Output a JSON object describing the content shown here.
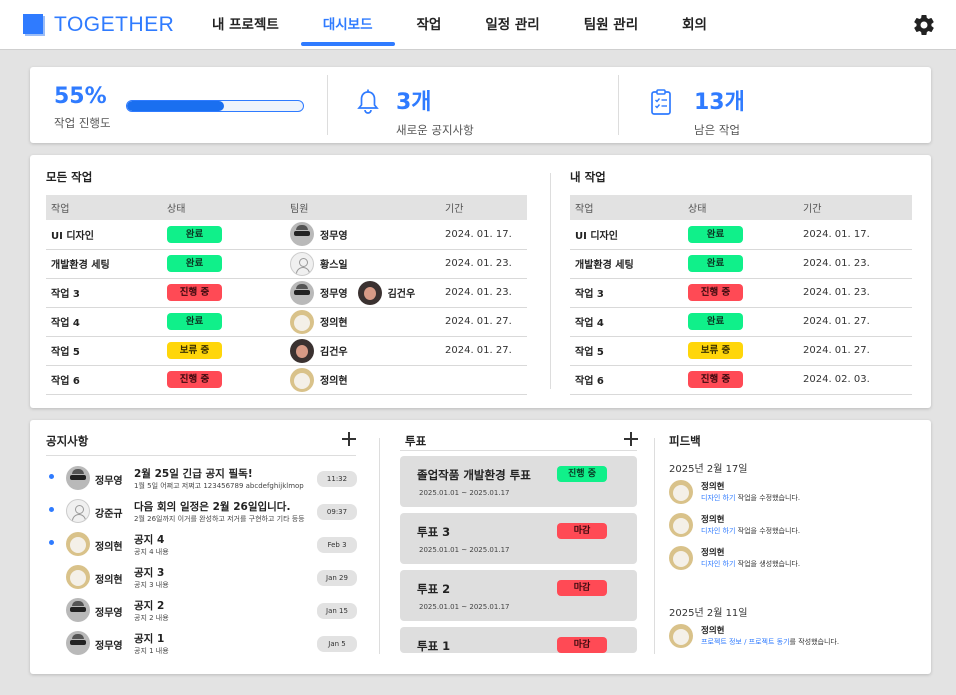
{
  "app": {
    "logo": "TOGETHER",
    "accent": "#2f7bff"
  },
  "nav": {
    "items": [
      "내 프로젝트",
      "대시보드",
      "작업",
      "일정 관리",
      "팀원 관리",
      "회의"
    ],
    "active": "대시보드"
  },
  "stats": {
    "progress": {
      "value": "55%",
      "label": "작업 진행도",
      "fraction": 0.55
    },
    "notices": {
      "value": "3개",
      "label": "새로운 공지사항"
    },
    "remaining": {
      "value": "13개",
      "label": "남은 작업"
    }
  },
  "all_tasks": {
    "title": "모든 작업",
    "headers": [
      "작업",
      "상태",
      "팀원",
      "기간"
    ],
    "rows": [
      {
        "task": "UI 디자인",
        "status": "완료",
        "members": [
          {
            "name": "정무영",
            "avatar": "guy"
          }
        ],
        "date": "2024. 01. 17."
      },
      {
        "task": "개발환경 세팅",
        "status": "완료",
        "members": [
          {
            "name": "황스일",
            "avatar": "blank"
          }
        ],
        "date": "2024. 01. 23."
      },
      {
        "task": "작업 3",
        "status": "진행 중",
        "members": [
          {
            "name": "정무영",
            "avatar": "guy"
          },
          {
            "name": "김건우",
            "avatar": "dark"
          }
        ],
        "date": "2024. 01. 23."
      },
      {
        "task": "작업 4",
        "status": "완료",
        "members": [
          {
            "name": "정의현",
            "avatar": "cat"
          }
        ],
        "date": "2024. 01. 27."
      },
      {
        "task": "작업 5",
        "status": "보류 중",
        "members": [
          {
            "name": "김건우",
            "avatar": "dark"
          }
        ],
        "date": "2024. 01. 27."
      },
      {
        "task": "작업 6",
        "status": "진행 중",
        "members": [
          {
            "name": "정의현",
            "avatar": "cat"
          }
        ],
        "date": ""
      }
    ]
  },
  "my_tasks": {
    "title": "내 작업",
    "headers": [
      "작업",
      "상태",
      "기간"
    ],
    "rows": [
      {
        "task": "UI 디자인",
        "status": "완료",
        "date": "2024. 01. 17."
      },
      {
        "task": "개발환경 세팅",
        "status": "완료",
        "date": "2024. 01. 23."
      },
      {
        "task": "작업 3",
        "status": "진행 중",
        "date": "2024. 01. 23."
      },
      {
        "task": "작업 4",
        "status": "완료",
        "date": "2024. 01. 27."
      },
      {
        "task": "작업 5",
        "status": "보류 중",
        "date": "2024. 01. 27."
      },
      {
        "task": "작업 6",
        "status": "진행 중",
        "date": "2024. 02. 03."
      }
    ]
  },
  "status_colors": {
    "완료": "#10f08a",
    "진행 중": "#ff4a55",
    "보류 중": "#ffd60a",
    "마감": "#ff4a55"
  },
  "notices": {
    "title": "공지사항",
    "items": [
      {
        "unread": true,
        "name": "정무영",
        "avatar": "guy",
        "title": "2월 25일 긴급 공지 필독!",
        "sub": "1월 5일 어쩌고 저쩌고 123456789 abcdefghijklmop",
        "time": "11:32"
      },
      {
        "unread": true,
        "name": "강준규",
        "avatar": "blank",
        "title": "다음 회의 일정은 2월 26일입니다.",
        "sub": "2월 26일까지 이거를 완성하고 저거를 구현하고 기타 등등",
        "time": "09:37"
      },
      {
        "unread": true,
        "name": "정의현",
        "avatar": "cat",
        "title": "공지 4",
        "sub": "공지 4 내용",
        "time": "Feb 3"
      },
      {
        "unread": false,
        "name": "정의현",
        "avatar": "cat",
        "title": "공지 3",
        "sub": "공지 3 내용",
        "time": "Jan 29"
      },
      {
        "unread": false,
        "name": "정무영",
        "avatar": "guy",
        "title": "공지 2",
        "sub": "공지 2 내용",
        "time": "Jan 15"
      },
      {
        "unread": false,
        "name": "정무영",
        "avatar": "guy",
        "title": "공지 1",
        "sub": "공지 1 내용",
        "time": "Jan 5"
      }
    ]
  },
  "votes": {
    "title": "투표",
    "items": [
      {
        "title": "졸업작품 개발환경 투표",
        "dates": "2025.01.01 ~ 2025.01.17",
        "status": "진행 중"
      },
      {
        "title": "투표 3",
        "dates": "2025.01.01 ~ 2025.01.17",
        "status": "마감"
      },
      {
        "title": "투표 2",
        "dates": "2025.01.01 ~ 2025.01.17",
        "status": "마감"
      },
      {
        "title": "투표 1",
        "dates": "",
        "status": "마감"
      }
    ]
  },
  "feedback": {
    "title": "피드백",
    "groups": [
      {
        "date": "2025년 2월 17일",
        "items": [
          {
            "name": "정의현",
            "link": "디자인 하기",
            "text": " 작업을 수정했습니다."
          },
          {
            "name": "정의현",
            "link": "디자인 하기",
            "text": " 작업을 수정했습니다."
          },
          {
            "name": "정의현",
            "link": "디자인 하기",
            "text": " 작업을 생성했습니다."
          }
        ]
      },
      {
        "date": "2025년 2월 11일",
        "items": [
          {
            "name": "정의현",
            "link": "프로젝트 정보 / 프로젝트 동기",
            "text": "를 작성했습니다."
          }
        ]
      }
    ]
  }
}
